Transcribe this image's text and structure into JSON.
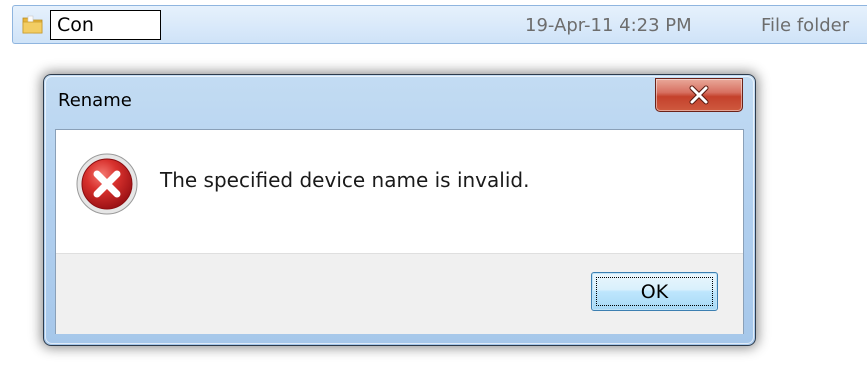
{
  "explorer": {
    "file_row": {
      "icon": "folder-icon",
      "name_value": "Con",
      "date_modified": "19-Apr-11 4:23 PM",
      "type": "File folder"
    }
  },
  "dialog": {
    "title": "Rename",
    "close_icon": "close-icon",
    "error_icon": "error-icon",
    "message": "The specified device name is invalid.",
    "ok_label": "OK"
  },
  "colors": {
    "error_red": "#c8232b",
    "close_button_red": "#c4412c",
    "title_bar_blue": "#b2d0ef",
    "selection_blue": "#cfe3f8",
    "folder_yellow": "#f3cd63"
  }
}
